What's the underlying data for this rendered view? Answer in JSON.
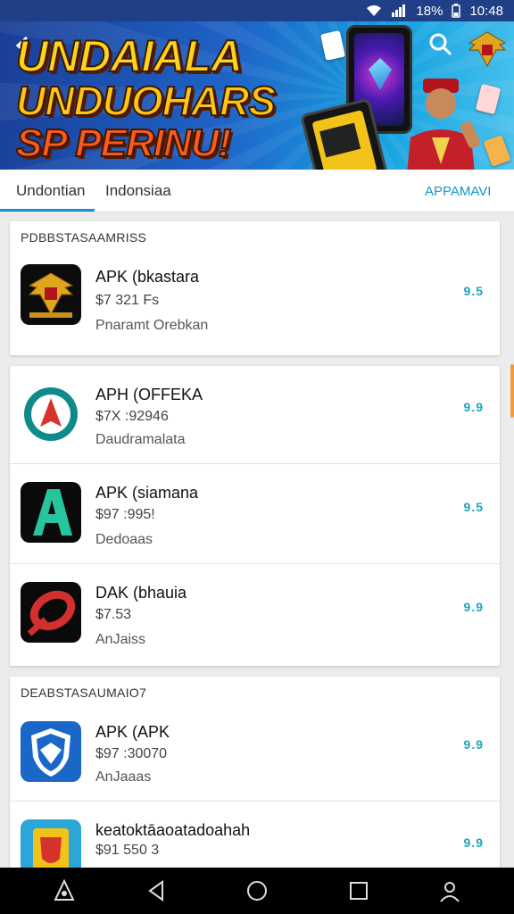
{
  "status_bar": {
    "battery": "18%",
    "time": "10:48",
    "icons": [
      "wifi-icon",
      "signal-icon",
      "battery-icon"
    ]
  },
  "banner": {
    "line1": "UNDAIALA",
    "line2": "UNDUOHARS",
    "line3": "SP PERINU!"
  },
  "tabs": {
    "tab1": "Undontian",
    "tab2": "Indonsiaa",
    "tab3": "APPAMAVI"
  },
  "sections": {
    "s1_header": "PDBBSTASAAMRISS",
    "s3_header": "DEABSTASAUMAIO7"
  },
  "apps": {
    "a1": {
      "name": "APK (bkastara",
      "price": "$7 321 Fs",
      "sub": "Pnaramt Orebkan",
      "rating": "9.5"
    },
    "a2": {
      "name": "APH (OFFEKA",
      "price": "$7X :92946",
      "sub": "Daudramalata",
      "rating": "9.9"
    },
    "a3": {
      "name": "APK (siamana",
      "price": "$97 :995!",
      "sub": "Dedoaas",
      "rating": "9.5"
    },
    "a4": {
      "name": "DAK (bhauia",
      "price": "$7.53",
      "sub": "AnJaiss",
      "rating": "9.9"
    },
    "a5": {
      "name": "APK (APK",
      "price": "$97 :30070",
      "sub": "AnJaaas",
      "rating": "9.9"
    },
    "a6": {
      "name": "keatoktāaoatadoahah",
      "price": "$91 550 3",
      "sub": "",
      "rating": "9.9"
    }
  },
  "colors": {
    "accent": "#1b8fd3",
    "rating": "#1aa7b8",
    "status_bar": "#1f3f86",
    "nav_bar": "#000000"
  },
  "nav": [
    "app-logo-icon",
    "back-icon",
    "home-icon",
    "recents-icon",
    "profile-icon"
  ]
}
